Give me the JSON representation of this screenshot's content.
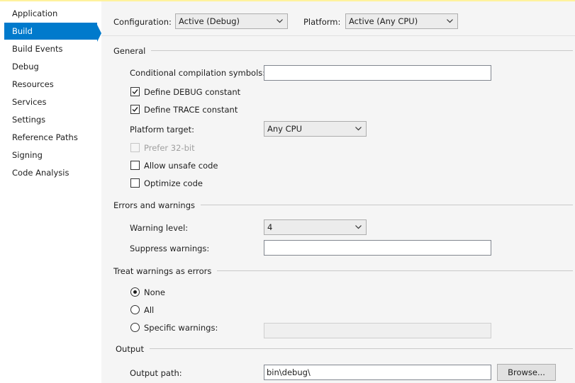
{
  "sidebar": {
    "items": [
      {
        "label": "Application"
      },
      {
        "label": "Build"
      },
      {
        "label": "Build Events"
      },
      {
        "label": "Debug"
      },
      {
        "label": "Resources"
      },
      {
        "label": "Services"
      },
      {
        "label": "Settings"
      },
      {
        "label": "Reference Paths"
      },
      {
        "label": "Signing"
      },
      {
        "label": "Code Analysis"
      }
    ],
    "active_item": "Build"
  },
  "header": {
    "configuration_label": "Configuration:",
    "configuration_value": "Active (Debug)",
    "platform_label": "Platform:",
    "platform_value": "Active (Any CPU)"
  },
  "general": {
    "title": "General",
    "conditional_symbols_label": "Conditional compilation symbols:",
    "conditional_symbols_value": "",
    "define_debug_label": "Define DEBUG constant",
    "define_debug_checked": true,
    "define_trace_label": "Define TRACE constant",
    "define_trace_checked": true,
    "platform_target_label": "Platform target:",
    "platform_target_value": "Any CPU",
    "prefer32_label": "Prefer 32-bit",
    "prefer32_checked": false,
    "allow_unsafe_label": "Allow unsafe code",
    "allow_unsafe_checked": false,
    "optimize_label": "Optimize code",
    "optimize_checked": false
  },
  "errors": {
    "title": "Errors and warnings",
    "warning_level_label": "Warning level:",
    "warning_level_value": "4",
    "suppress_label": "Suppress warnings:",
    "suppress_value": ""
  },
  "treat_warnings": {
    "title": "Treat warnings as errors",
    "options": [
      {
        "label": "None",
        "selected": true
      },
      {
        "label": "All",
        "selected": false
      },
      {
        "label": "Specific warnings:",
        "selected": false
      }
    ],
    "specific_value": ""
  },
  "output": {
    "title": "Output",
    "output_path_label": "Output path:",
    "output_path_value": "bin\\debug\\",
    "browse_label": "Browse..."
  },
  "colors": {
    "accent": "#007acc",
    "top_highlight": "#fff29d"
  }
}
